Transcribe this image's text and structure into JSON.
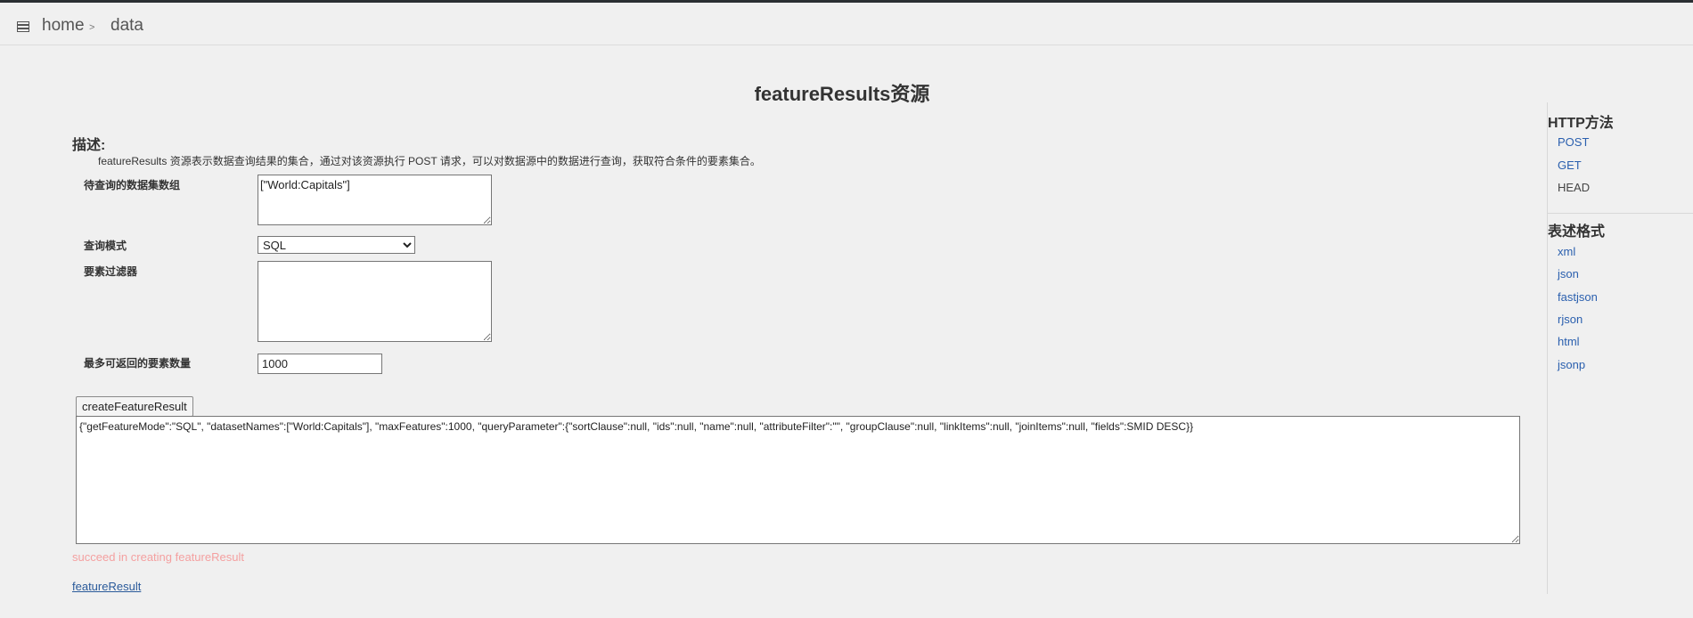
{
  "navbar": {
    "menu_icon": "list-icon",
    "breadcrumb": {
      "home": "home",
      "separator": ">",
      "current": "data"
    }
  },
  "page": {
    "title": "featureResults资源",
    "description_heading": "描述:",
    "description": "featureResults 资源表示数据查询结果的集合，通过对该资源执行 POST 请求，可以对数据源中的数据进行查询，获取符合条件的要素集合。"
  },
  "form": {
    "datasets_label": "待查询的数据集数组",
    "datasets_value": "[\"World:Capitals\"]",
    "mode_label": "查询模式",
    "mode_selected": "SQL",
    "filter_label": "要素过滤器",
    "filter_value": "",
    "max_label": "最多可返回的要素数量",
    "max_value": "1000",
    "create_button": "createFeatureResult",
    "result_json": "{\"getFeatureMode\":\"SQL\", \"datasetNames\":[\"World:Capitals\"], \"maxFeatures\":1000, \"queryParameter\":{\"sortClause\":null, \"ids\":null, \"name\":null, \"attributeFilter\":\"\", \"groupClause\":null, \"linkItems\":null, \"joinItems\":null, \"fields\":SMID DESC}}",
    "status_message": "succeed in creating featureResult",
    "result_link": "featureResult"
  },
  "sidebar": {
    "http_heading": "HTTP方法",
    "methods": [
      "POST",
      "GET",
      "HEAD"
    ],
    "format_heading": "表述格式",
    "formats": [
      "xml",
      "json",
      "fastjson",
      "rjson",
      "html",
      "jsonp"
    ]
  },
  "colors": {
    "link": "#2a5fae",
    "status_text": "#f4a0a0",
    "top_border": "#2b2f33"
  }
}
